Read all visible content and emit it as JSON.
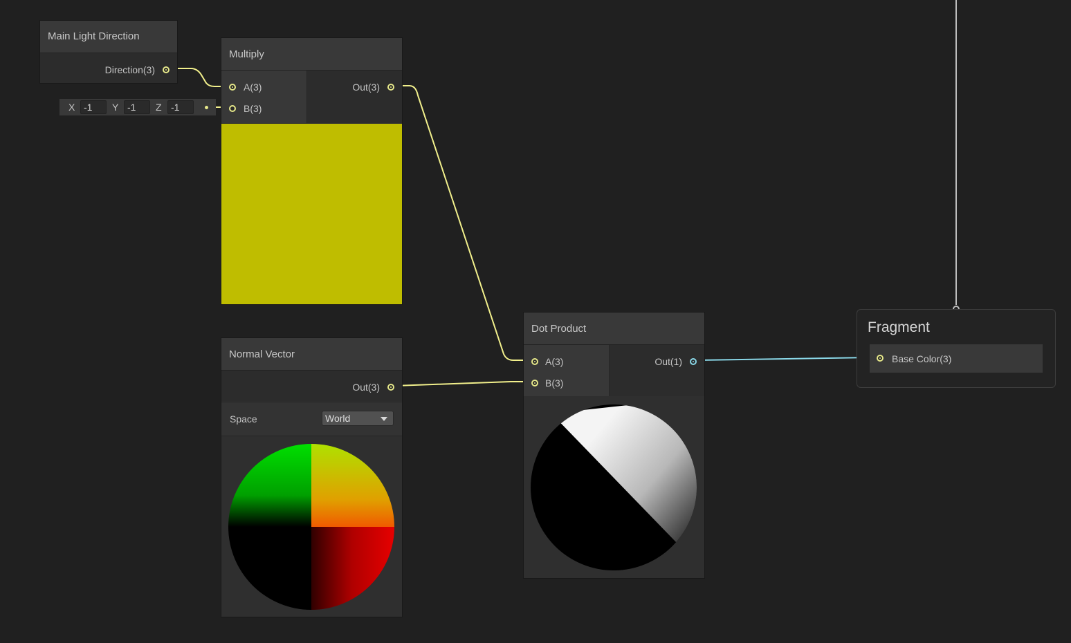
{
  "nodes": {
    "main_light": {
      "title": "Main Light Direction",
      "output": "Direction(3)"
    },
    "multiply": {
      "title": "Multiply",
      "input_a": "A(3)",
      "input_b": "B(3)",
      "output": "Out(3)",
      "preview_color": "#bfbd00"
    },
    "vector_b": {
      "x_label": "X",
      "x_value": "-1",
      "y_label": "Y",
      "y_value": "-1",
      "z_label": "Z",
      "z_value": "-1"
    },
    "normal_vector": {
      "title": "Normal Vector",
      "output": "Out(3)",
      "space_label": "Space",
      "space_value": "World"
    },
    "dot_product": {
      "title": "Dot Product",
      "input_a": "A(3)",
      "input_b": "B(3)",
      "output": "Out(1)"
    }
  },
  "fragment": {
    "title": "Fragment",
    "port": "Base Color(3)"
  },
  "colors": {
    "vector3_wire": "#f2f08c",
    "float_wire": "#8ad8e8",
    "vertex_wire": "#bdbdbd",
    "background": "#202020"
  }
}
